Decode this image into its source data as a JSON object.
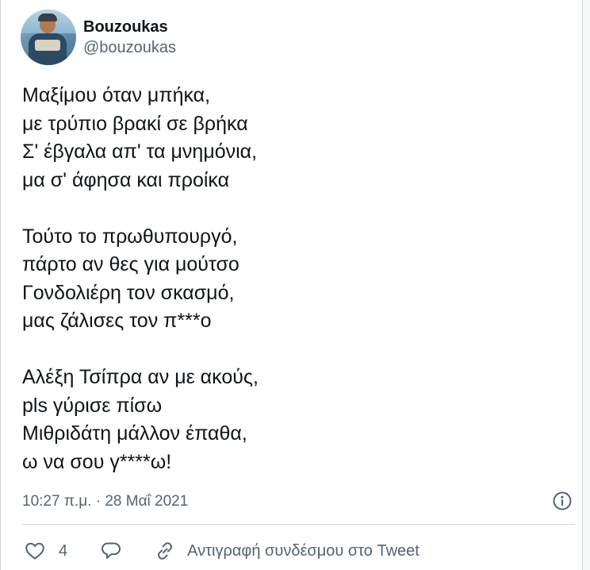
{
  "author": {
    "display_name": "Bouzoukas",
    "handle": "@bouzoukas",
    "avatar_icon": "profile-photo"
  },
  "tweet": {
    "stanzas": [
      [
        "Μαξίμου όταν μπήκα,",
        "με τρύπιο βρακί σε βρήκα",
        "Σ' έβγαλα απ' τα μνημόνια,",
        "μα σ' άφησα και προίκα"
      ],
      [
        "Τούτο το πρωθυπουργό,",
        "πάρτο αν θες για μούτσο",
        "Γονδολιέρη τον σκασμό,",
        "μας ζάλισες τον π***ο"
      ],
      [
        "Αλέξη Τσίπρα αν με ακούς,",
        "pls γύρισε πίσω",
        "Μιθριδάτη μάλλον έπαθα,",
        "ω να σου γ****ω!"
      ]
    ],
    "timestamp": "10:27 π.μ. · 28 Μαΐ 2021"
  },
  "actions": {
    "like_count": "4",
    "copy_link_label": "Αντιγραφή συνδέσμου στο Tweet"
  },
  "icons": {
    "info": "info-icon",
    "like": "heart-icon",
    "reply": "reply-bubble-icon",
    "copy_link": "link-icon"
  },
  "colors": {
    "text": "#0f1419",
    "secondary": "#536471",
    "border": "#cfd9de"
  }
}
